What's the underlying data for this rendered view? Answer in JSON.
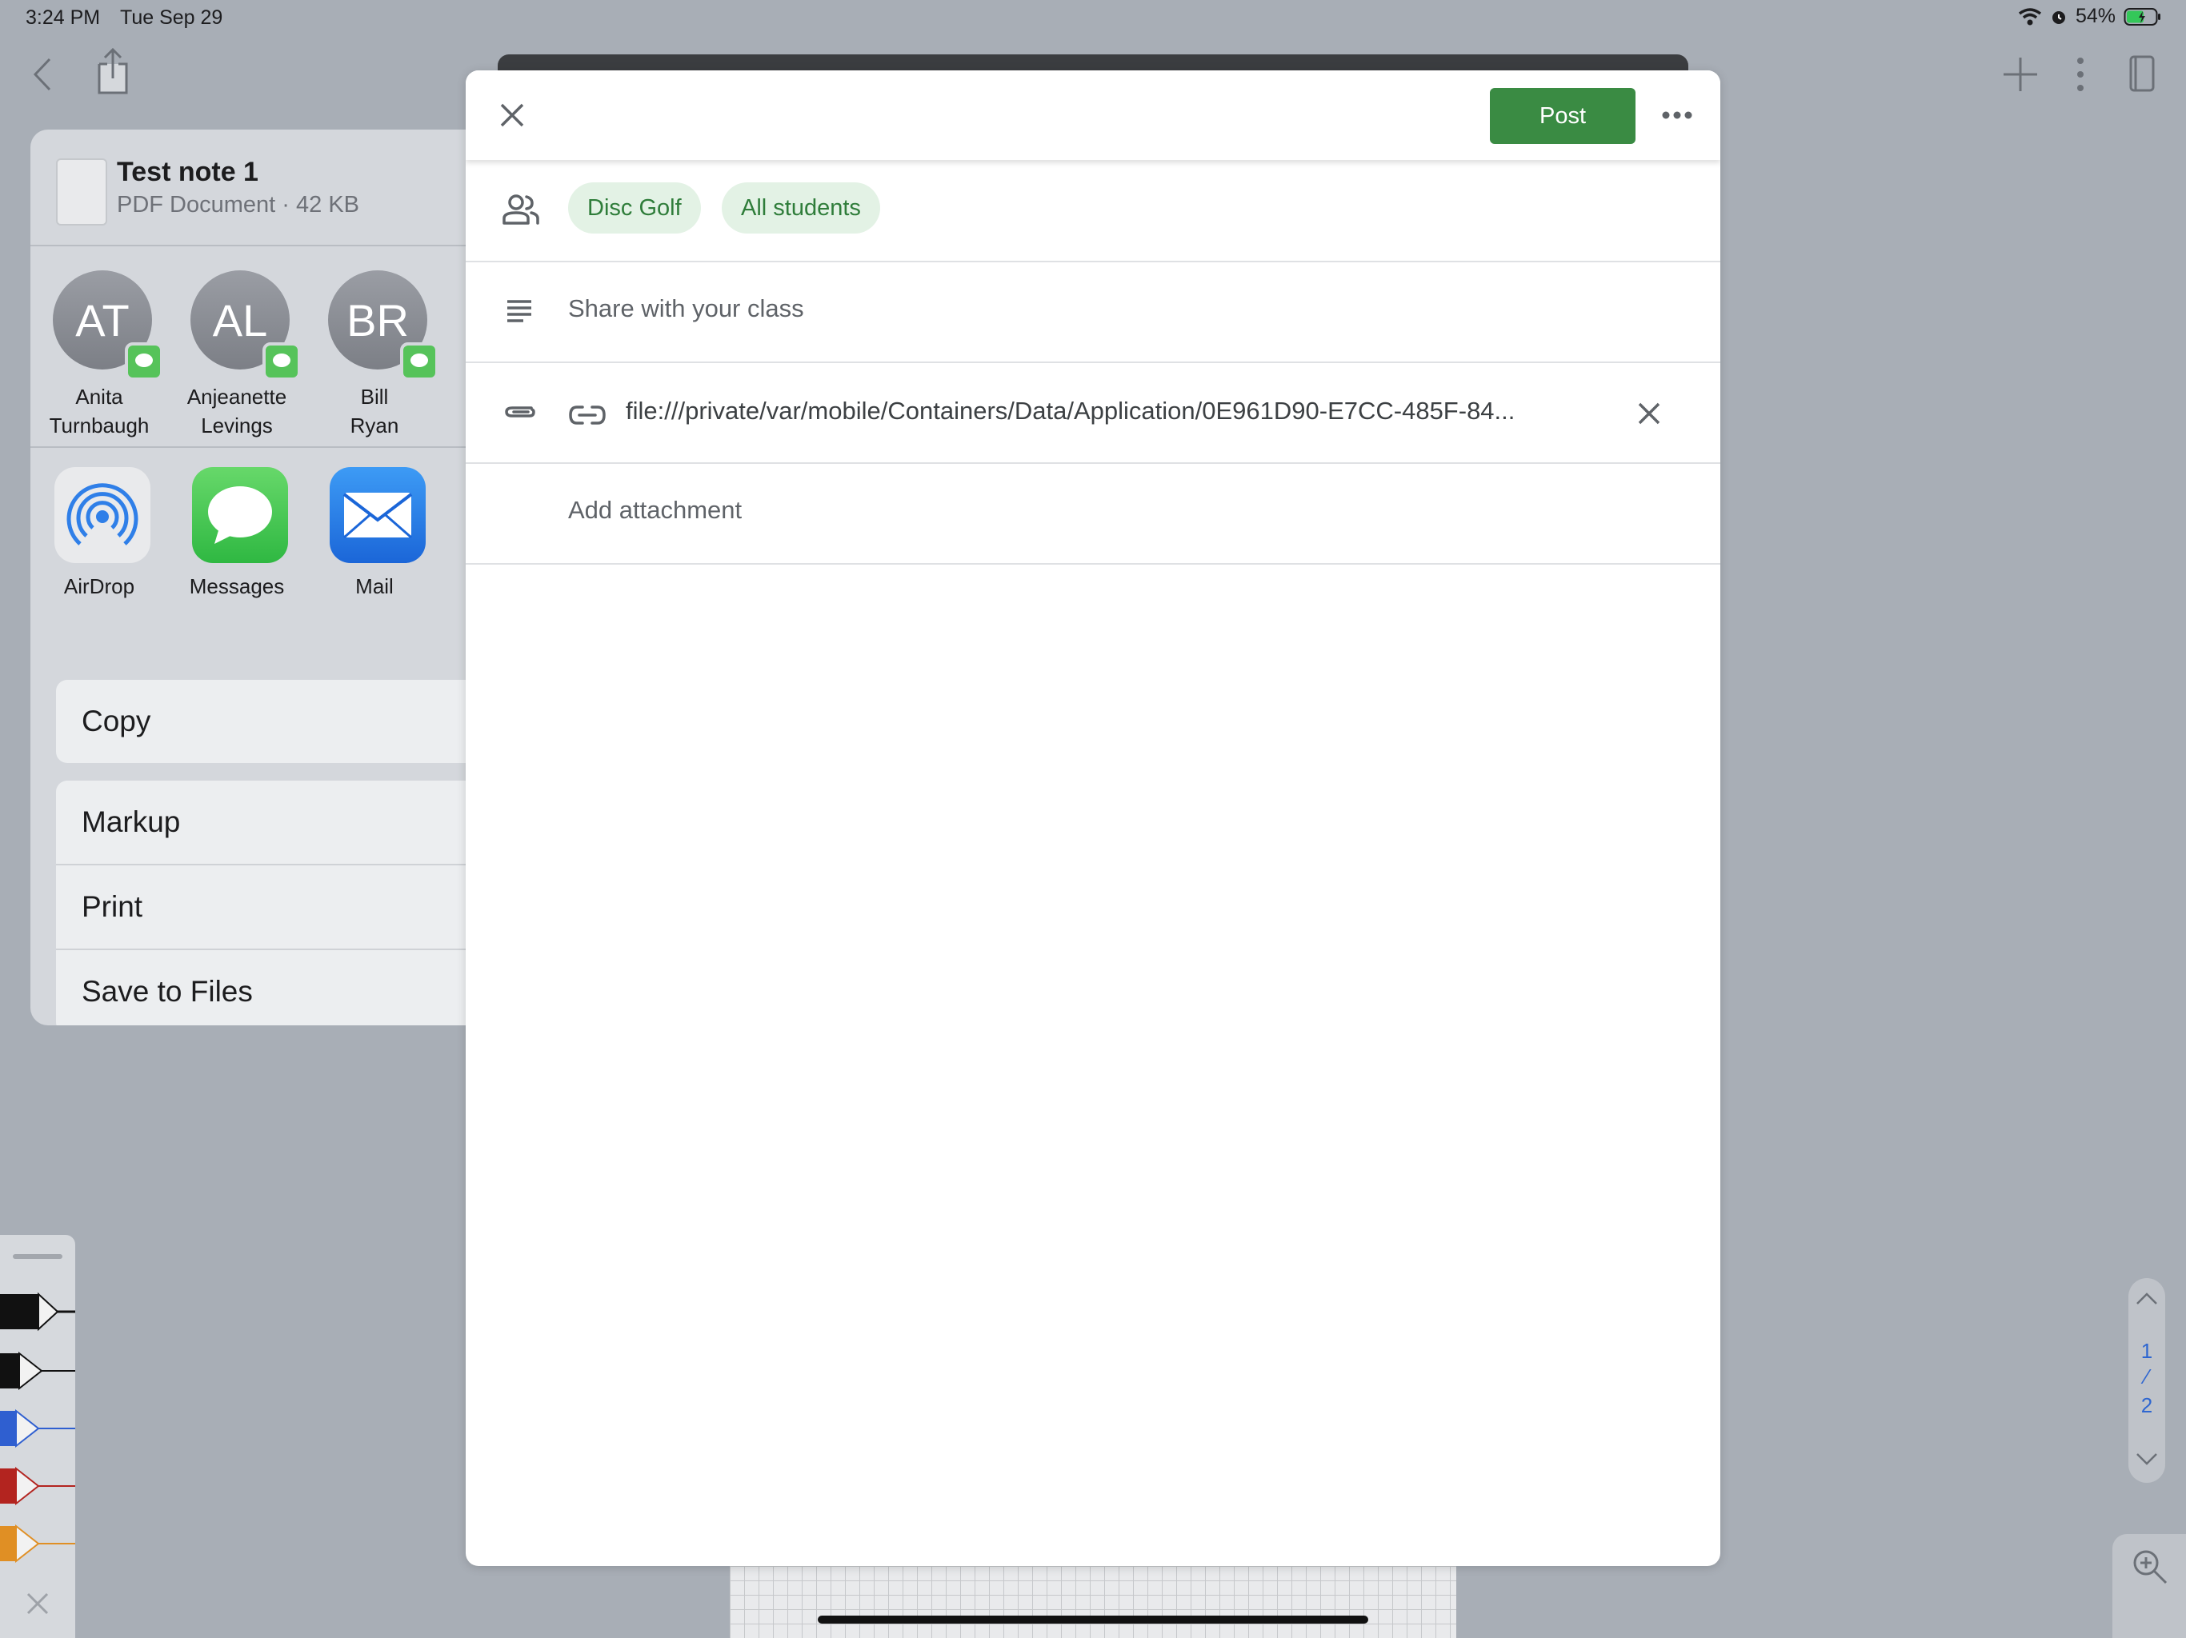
{
  "status_bar": {
    "time": "3:24 PM",
    "date": "Tue Sep 29",
    "battery": "54%"
  },
  "share_sheet": {
    "doc_title": "Test note 1",
    "doc_subtitle": "PDF Document · 42 KB",
    "contacts": [
      {
        "initials": "AT",
        "first": "Anita",
        "last": "Turnbaugh"
      },
      {
        "initials": "AL",
        "first": "Anjeanette",
        "last": "Levings"
      },
      {
        "initials": "BR",
        "first": "Bill",
        "last": "Ryan"
      }
    ],
    "apps": [
      {
        "label": "AirDrop",
        "icon": "airdrop-icon"
      },
      {
        "label": "Messages",
        "icon": "messages-icon"
      },
      {
        "label": "Mail",
        "icon": "mail-icon"
      }
    ],
    "actions": [
      "Copy",
      "Markup",
      "Print",
      "Save to Files"
    ]
  },
  "modal": {
    "post_label": "Post",
    "class_chip": "Disc Golf",
    "audience_chip": "All students",
    "share_placeholder": "Share with your class",
    "attachment_link": "file:///private/var/mobile/Containers/Data/Application/0E961D90-E7CC-485F-84...",
    "add_attachment": "Add attachment"
  },
  "page_indicator": {
    "current": "1",
    "separator": "⁄",
    "total": "2"
  },
  "colors": {
    "post_green": "#3a8b43",
    "chip_bg": "#e3f2e5",
    "chip_text": "#2f7d3a",
    "page_number_blue": "#2e66d0"
  }
}
